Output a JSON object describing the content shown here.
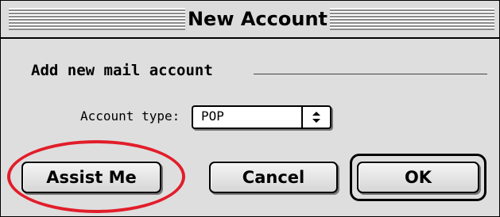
{
  "window": {
    "title": "New Account"
  },
  "section": {
    "heading": "Add new mail account"
  },
  "account_type": {
    "label": "Account type:",
    "selected": "POP",
    "arrow_glyph": "↕"
  },
  "buttons": {
    "assist": "Assist Me",
    "cancel": "Cancel",
    "ok": "OK"
  },
  "annotation": {
    "color": "#e21d2a"
  }
}
